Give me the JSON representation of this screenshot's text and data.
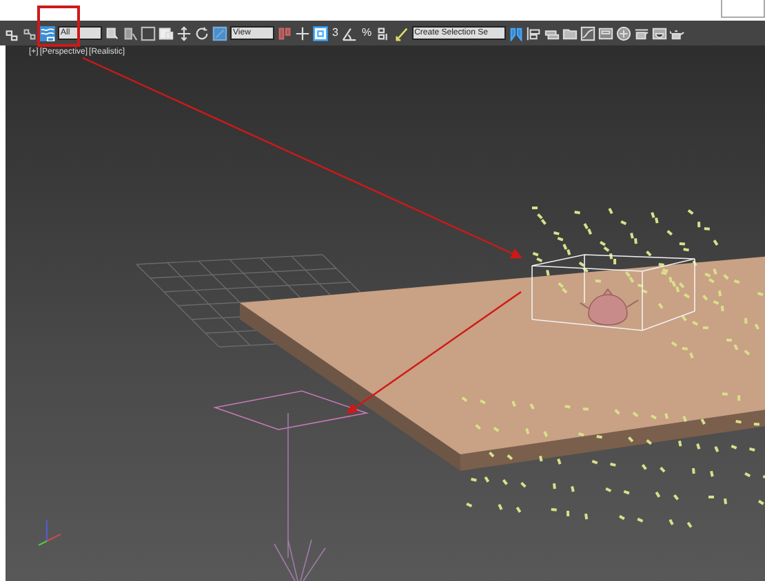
{
  "toolbar": {
    "selection_filter": "All",
    "reference_coordinate": "View",
    "snap_marks": [
      "3",
      "%"
    ],
    "named_selection": "Create Selection Se"
  },
  "viewport": {
    "label_parts": [
      "[+]",
      "[Perspective]",
      "[Realistic]"
    ]
  }
}
